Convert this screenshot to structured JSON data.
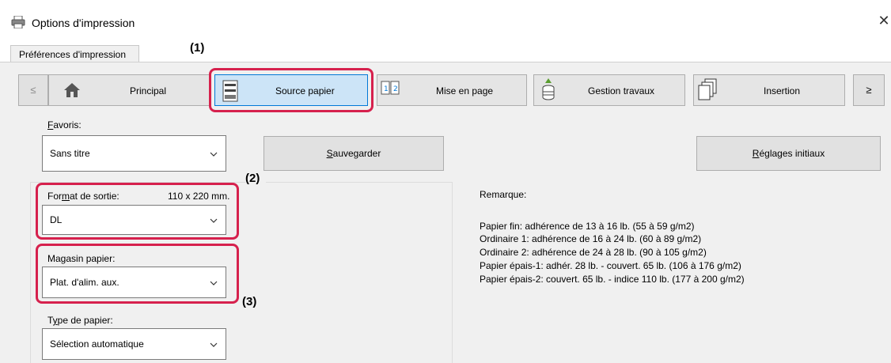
{
  "window": {
    "title": "Options d'impression",
    "close_glyph": "✕"
  },
  "tab": {
    "label": "Préférences d'impression"
  },
  "callouts": {
    "c1": "(1)",
    "c2": "(2)",
    "c3": "(3)"
  },
  "toolbar": {
    "prev_glyph": "≤",
    "next_glyph": "≥",
    "buttons": [
      {
        "label": "Principal",
        "icon": "home-icon"
      },
      {
        "label": "Source papier",
        "icon": "printer-tray-icon",
        "selected": true
      },
      {
        "label": "Mise en page",
        "icon": "page-layout-icon"
      },
      {
        "label": "Gestion travaux",
        "icon": "job-stack-icon"
      },
      {
        "label": "Insertion",
        "icon": "insert-pages-icon"
      }
    ]
  },
  "favorites": {
    "label_prefix": "F",
    "label_rest": "avoris:",
    "value": "Sans titre",
    "save_prefix": "S",
    "save_rest": "auvegarder",
    "reset_prefix": "R",
    "reset_rest": "églages initiaux"
  },
  "output_size": {
    "label_a": "For",
    "label_u": "m",
    "label_b": "at de sortie:",
    "dimension": "110 x 220 mm.",
    "value": "DL"
  },
  "paper_tray": {
    "label_a": "Ma",
    "label_u": "g",
    "label_b": "asin papier:",
    "value": "Plat. d'alim. aux."
  },
  "paper_type": {
    "label_a": "T",
    "label_u": "y",
    "label_b": "pe de papier:",
    "value": "Sélection automatique"
  },
  "remark": {
    "title": "Remarque:",
    "lines": [
      "Papier fin: adhérence de 13 à 16 lb. (55 à 59 g/m2)",
      "Ordinaire 1: adhérence de 16 à 24 lb. (60 à 89 g/m2)",
      "Ordinaire 2: adhérence de 24 à 28 lb. (90 à 105 g/m2)",
      "Papier épais-1: adhér. 28 lb. - couvert. 65 lb. (106 à 176 g/m2)",
      "Papier épais-2: couvert. 65 lb. - indice 110 lb. (177 à 200 g/m2)"
    ]
  },
  "colors": {
    "accent": "#0078d7",
    "highlight": "#d6214d",
    "selected_bg": "#cce4f7"
  }
}
